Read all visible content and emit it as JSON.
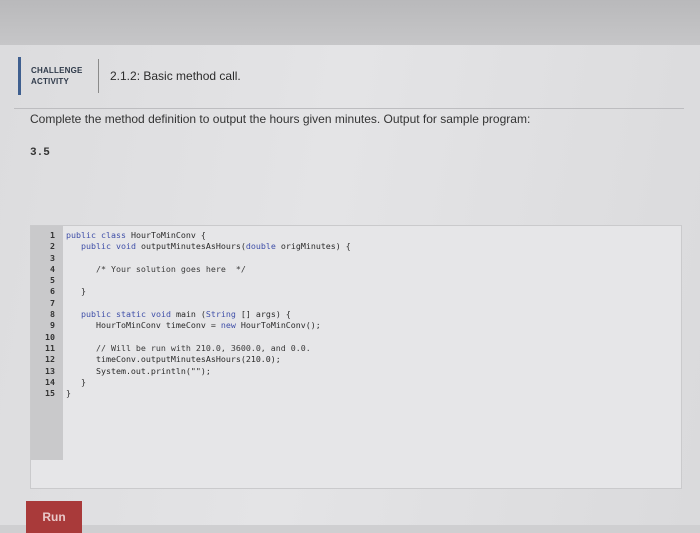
{
  "header": {
    "badge_line1": "CHALLENGE",
    "badge_line2": "ACTIVITY",
    "title": "2.1.2: Basic method call."
  },
  "prompt": "Complete the method definition to output the hours given minutes. Output for sample program:",
  "sample_output": "3.5",
  "code_lines": [
    {
      "n": "1",
      "text": "public class HourToMinConv {"
    },
    {
      "n": "2",
      "text": "   public void outputMinutesAsHours(double origMinutes) {"
    },
    {
      "n": "3",
      "text": ""
    },
    {
      "n": "4",
      "text": "      /* Your solution goes here  */"
    },
    {
      "n": "5",
      "text": ""
    },
    {
      "n": "6",
      "text": "   }"
    },
    {
      "n": "7",
      "text": ""
    },
    {
      "n": "8",
      "text": "   public static void main (String [] args) {"
    },
    {
      "n": "9",
      "text": "      HourToMinConv timeConv = new HourToMinConv();"
    },
    {
      "n": "10",
      "text": ""
    },
    {
      "n": "11",
      "text": "      // Will be run with 210.0, 3600.0, and 0.0."
    },
    {
      "n": "12",
      "text": "      timeConv.outputMinutesAsHours(210.0);"
    },
    {
      "n": "13",
      "text": "      System.out.println(\"\");"
    },
    {
      "n": "14",
      "text": "   }"
    },
    {
      "n": "15",
      "text": "}"
    }
  ],
  "run_button": "Run",
  "colors": {
    "accent": "#3f5f8f",
    "run": "#a93a3a",
    "keyword": "#3f4fa8"
  }
}
